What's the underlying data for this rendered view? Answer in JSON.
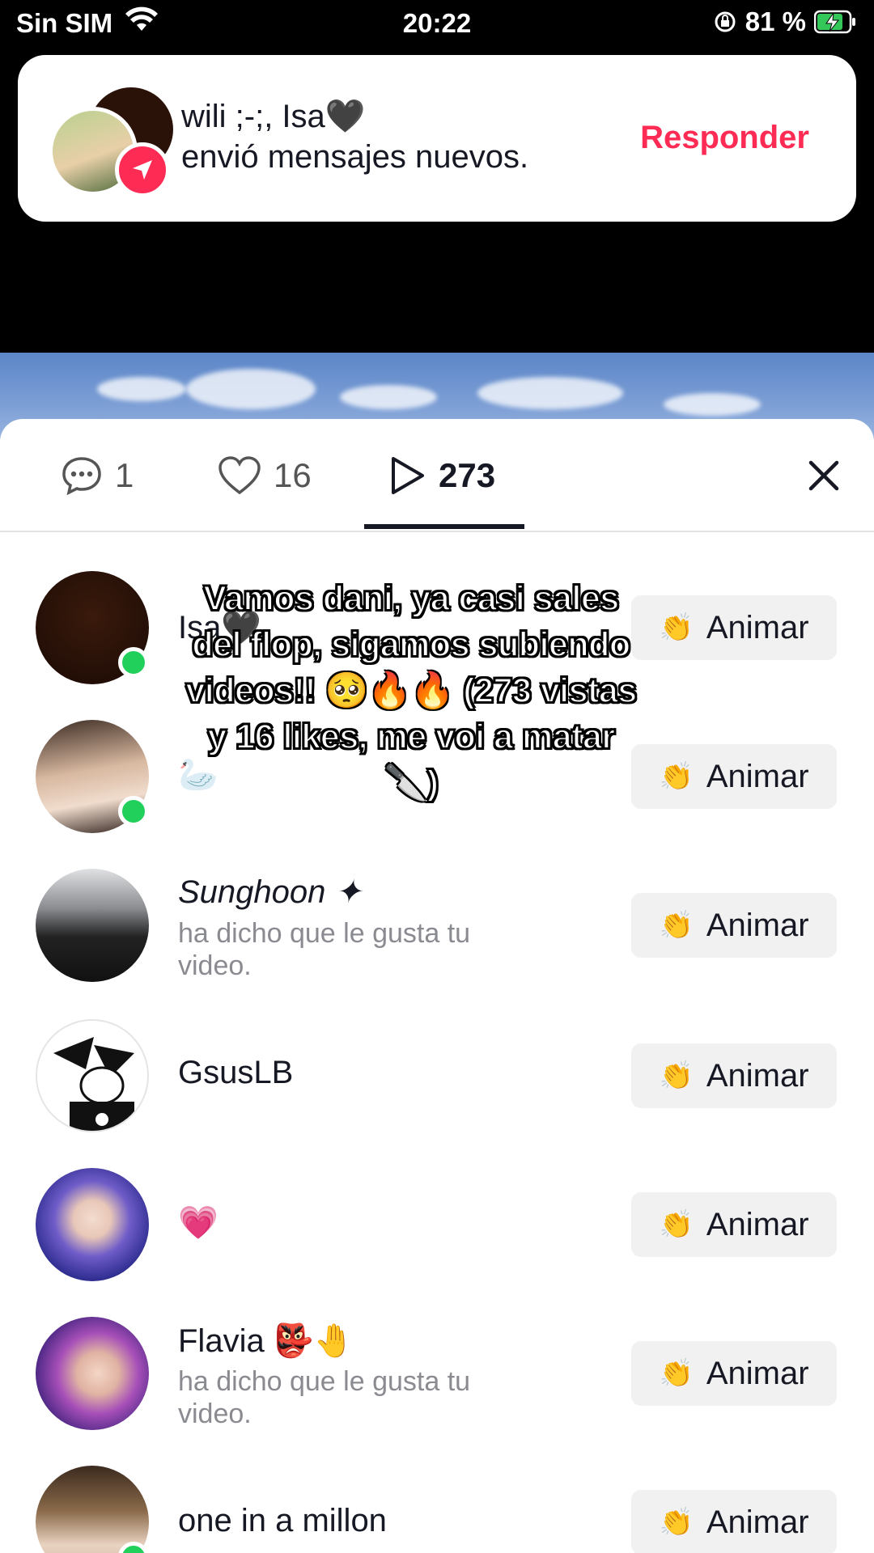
{
  "status_bar": {
    "carrier": "Sin SIM",
    "time": "20:22",
    "battery": "81 %",
    "icons": [
      "wifi-icon",
      "orientation-lock-icon",
      "battery-charging-icon"
    ]
  },
  "notification": {
    "title": "wili ;-;, Isa🖤",
    "body": "envió mensajes nuevos.",
    "action_label": "Responder",
    "accent_color": "#fe2c55"
  },
  "tabs": [
    {
      "icon": "comment-icon",
      "count": "1"
    },
    {
      "icon": "heart-icon",
      "count": "16"
    },
    {
      "icon": "play-icon",
      "count": "273",
      "active": true
    }
  ],
  "caption": "Vamos dani, ya casi sales del flop, sigamos subiendo videos!! 🥺🔥🔥 (273 vistas y 16 likes, me voi a matar 🔪)",
  "button_label": "Animar",
  "viewers": [
    {
      "name": "Isa🖤",
      "subtitle": "",
      "online": true
    },
    {
      "name": "🦢",
      "subtitle": "",
      "online": true
    },
    {
      "name": "Sunghoon ✦",
      "subtitle": "ha dicho que le gusta tu video.",
      "online": false
    },
    {
      "name": "GsusLB",
      "subtitle": "",
      "online": false
    },
    {
      "name": "💗",
      "subtitle": "",
      "online": false
    },
    {
      "name": "Flavia 👺🤚",
      "subtitle": "ha dicho que le gusta tu video.",
      "online": false
    },
    {
      "name": "one in a millon",
      "subtitle": "",
      "online": true
    }
  ]
}
